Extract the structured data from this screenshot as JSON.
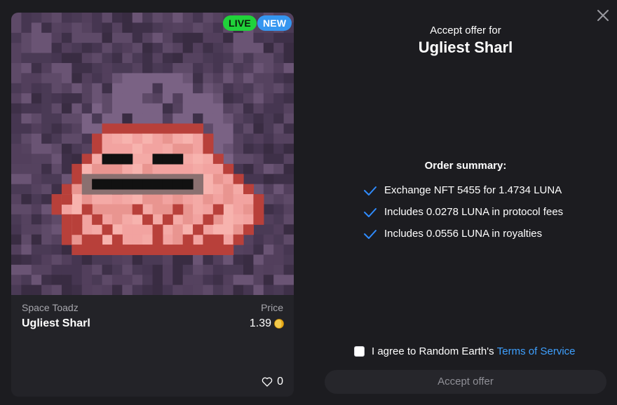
{
  "dialog": {
    "title_prefix": "Accept offer for",
    "title_name": "Ugliest Sharl"
  },
  "card": {
    "badges": {
      "live": "LIVE",
      "new": "NEW"
    },
    "collection": "Space Toadz",
    "name": "Ugliest Sharl",
    "price_label": "Price",
    "price_value": "1.39",
    "price_icon": "luna-coin-icon",
    "likes": "0"
  },
  "summary": {
    "heading": "Order summary:",
    "items": [
      "Exchange NFT 5455 for 1.4734 LUNA",
      "Includes 0.0278 LUNA in protocol fees",
      "Includes 0.0556 LUNA in royalties"
    ]
  },
  "agreement": {
    "text": "I agree to Random Earth's",
    "link": "Terms of Service",
    "checked": false
  },
  "actions": {
    "accept": "Accept offer"
  },
  "colors": {
    "background": "#1c1c20",
    "card": "#232328",
    "live_badge": "#20d23a",
    "new_badge": "#3596f0",
    "check": "#2f8cff",
    "link": "#3ea0ff"
  }
}
